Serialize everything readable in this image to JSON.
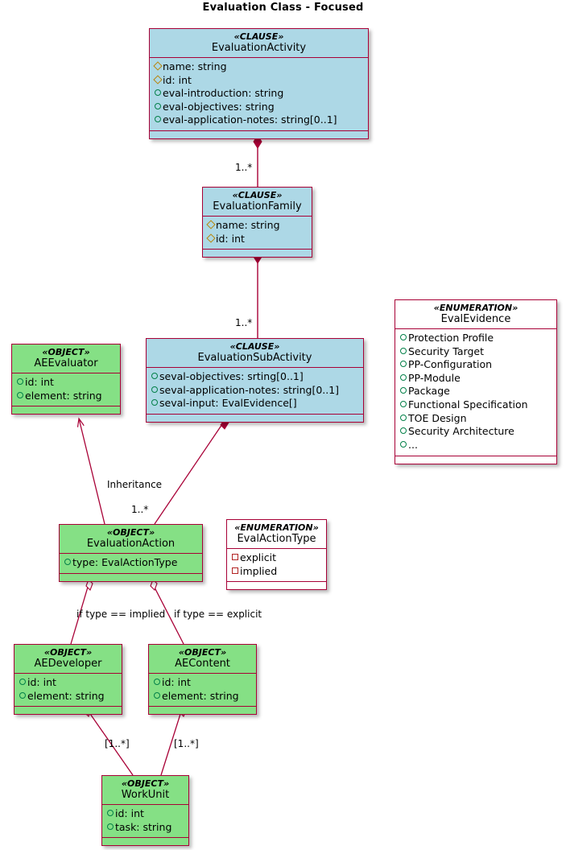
{
  "diagram": {
    "title": "Evaluation Class - Focused",
    "colors": {
      "border": "#A80036",
      "clause_fill": "#ADD8E6",
      "object_fill": "#85E085",
      "enum_fill": "#FFFFFF",
      "diamond_bullet": "#B8860B",
      "circle_bullet": "#038048",
      "square_bullet": "#B22222"
    }
  },
  "classes": {
    "evaluation_activity": {
      "stereotype": "«CLAUSE»",
      "name": "EvaluationActivity",
      "attributes": [
        {
          "bullet": "diamond",
          "text": "name: string"
        },
        {
          "bullet": "diamond",
          "text": "id: int"
        },
        {
          "bullet": "circle",
          "text": "eval-introduction: string"
        },
        {
          "bullet": "circle",
          "text": "eval-objectives: string"
        },
        {
          "bullet": "circle",
          "text": "eval-application-notes: string[0..1]"
        }
      ]
    },
    "evaluation_family": {
      "stereotype": "«CLAUSE»",
      "name": "EvaluationFamily",
      "attributes": [
        {
          "bullet": "diamond",
          "text": "name: string"
        },
        {
          "bullet": "diamond",
          "text": "id: int"
        }
      ]
    },
    "evaluation_subactivity": {
      "stereotype": "«CLAUSE»",
      "name": "EvaluationSubActivity",
      "attributes": [
        {
          "bullet": "circle",
          "text": "seval-objectives: srting[0..1]"
        },
        {
          "bullet": "circle",
          "text": "seval-application-notes: string[0..1]"
        },
        {
          "bullet": "circle",
          "text": "seval-input: EvalEvidence[]"
        }
      ]
    },
    "ae_evaluator": {
      "stereotype": "«OBJECT»",
      "name": "AEEvaluator",
      "attributes": [
        {
          "bullet": "circle",
          "text": "id: int"
        },
        {
          "bullet": "circle",
          "text": "element: string"
        }
      ]
    },
    "eval_evidence": {
      "stereotype": "«ENUMERATION»",
      "name": "EvalEvidence",
      "attributes": [
        {
          "bullet": "circle",
          "text": "Protection Profile"
        },
        {
          "bullet": "circle",
          "text": "Security Target"
        },
        {
          "bullet": "circle",
          "text": "PP-Configuration"
        },
        {
          "bullet": "circle",
          "text": "PP-Module"
        },
        {
          "bullet": "circle",
          "text": "Package"
        },
        {
          "bullet": "circle",
          "text": "Functional Specification"
        },
        {
          "bullet": "circle",
          "text": "TOE Design"
        },
        {
          "bullet": "circle",
          "text": "Security Architecture"
        },
        {
          "bullet": "circle",
          "text": "..."
        }
      ]
    },
    "evaluation_action": {
      "stereotype": "«OBJECT»",
      "name": "EvaluationAction",
      "attributes": [
        {
          "bullet": "circle",
          "text": "type: EvalActionType"
        }
      ]
    },
    "eval_action_type": {
      "stereotype": "«ENUMERATION»",
      "name": "EvalActionType",
      "attributes": [
        {
          "bullet": "square",
          "text": "explicit"
        },
        {
          "bullet": "square",
          "text": "implied"
        }
      ]
    },
    "ae_developer": {
      "stereotype": "«OBJECT»",
      "name": "AEDeveloper",
      "attributes": [
        {
          "bullet": "circle",
          "text": "id: int"
        },
        {
          "bullet": "circle",
          "text": "element: string"
        }
      ]
    },
    "ae_content": {
      "stereotype": "«OBJECT»",
      "name": "AEContent",
      "attributes": [
        {
          "bullet": "circle",
          "text": "id: int"
        },
        {
          "bullet": "circle",
          "text": "element: string"
        }
      ]
    },
    "work_unit": {
      "stereotype": "«OBJECT»",
      "name": "WorkUnit",
      "attributes": [
        {
          "bullet": "circle",
          "text": "id: int"
        },
        {
          "bullet": "circle",
          "text": "task: string"
        }
      ]
    }
  },
  "edge_labels": {
    "activity_family_mult": "1..*",
    "family_subactivity_mult": "1..*",
    "inheritance": "Inheritance",
    "subactivity_action_mult": "1..*",
    "implied_guard": "if type == implied",
    "explicit_guard": "if type == explicit",
    "developer_workunit_mult": "[1..*]",
    "content_workunit_mult": "[1..*]"
  }
}
